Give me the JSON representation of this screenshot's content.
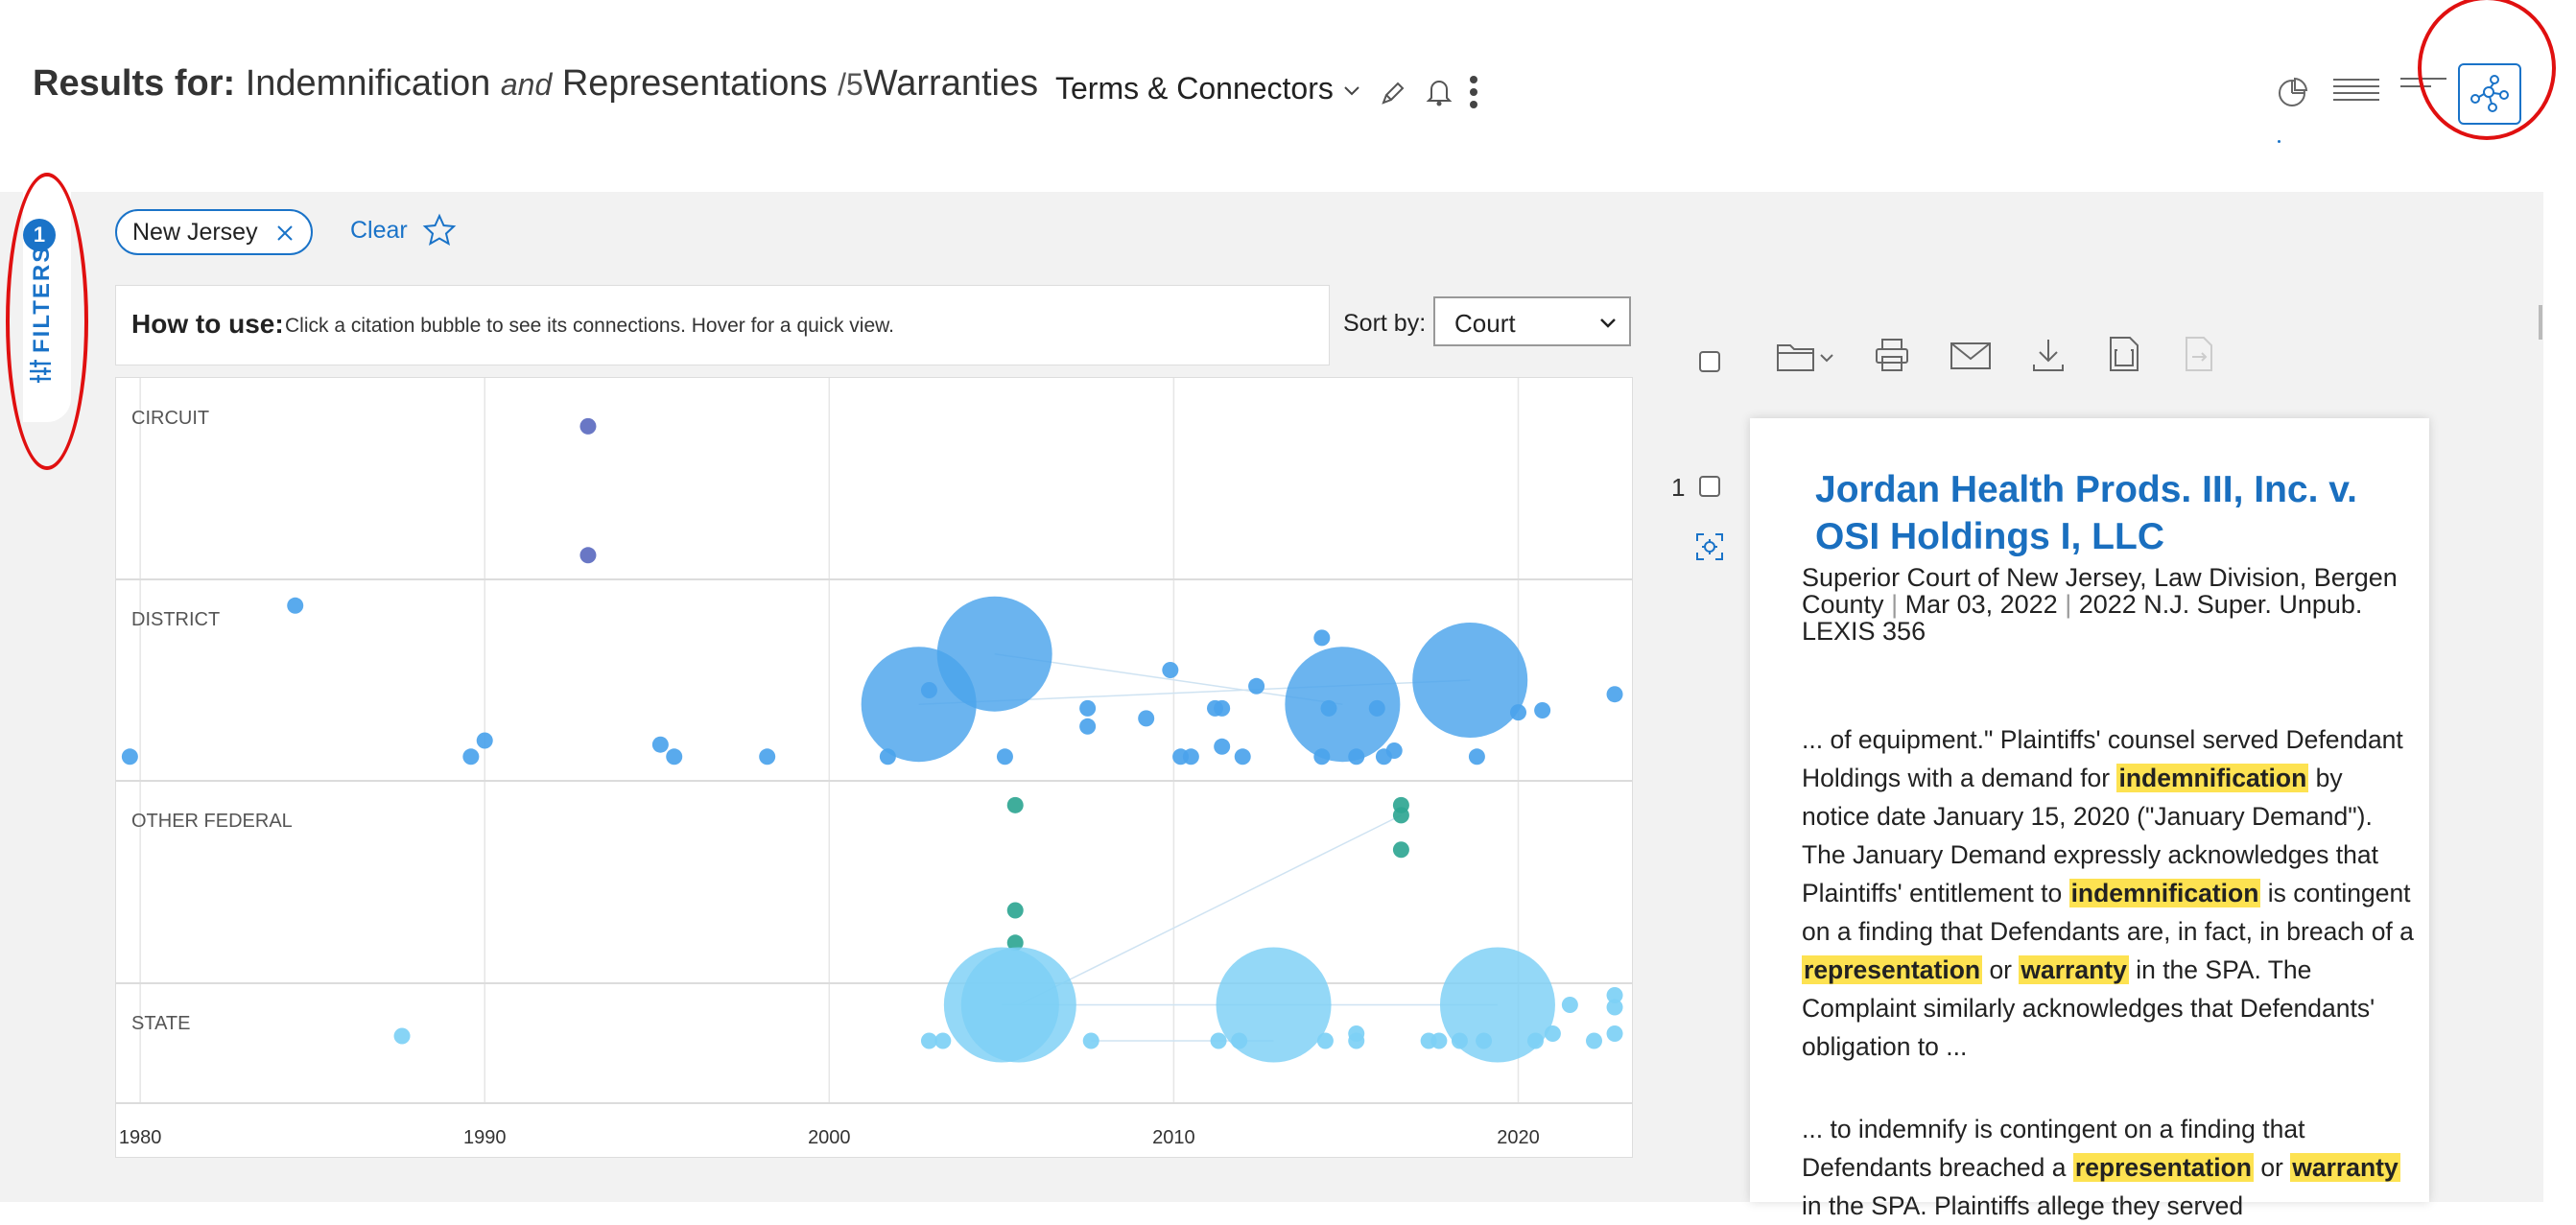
{
  "header": {
    "results_for_label": "Results for:",
    "query_term_1": "Indemnification",
    "query_connector_1": "and",
    "query_term_2": "Representations",
    "query_connector_2": "/5",
    "query_term_3": "Warranties",
    "search_type": "Terms & Connectors"
  },
  "filters": {
    "tab_label": "FILTERS",
    "count": "1",
    "active_chip": "New Jersey",
    "clear_label": "Clear"
  },
  "howto": {
    "label": "How to use:",
    "text": "Click a citation bubble to see its connections. Hover for a quick view."
  },
  "sort": {
    "label": "Sort by:",
    "selected": "Court"
  },
  "chart_data": {
    "type": "scatter",
    "categories": [
      "CIRCUIT",
      "DISTRICT",
      "OTHER FEDERAL",
      "STATE"
    ],
    "x_ticks": [
      "1980",
      "1990",
      "2000",
      "2010",
      "2020"
    ],
    "xlim": [
      1979.3,
      2023.3
    ],
    "series": [
      {
        "category": "CIRCUIT",
        "color": "#5c6bc0",
        "points": [
          {
            "x": 1993.0,
            "lane_pos": 0.24,
            "size": "small"
          },
          {
            "x": 1993.0,
            "lane_pos": 0.88,
            "size": "small"
          }
        ]
      },
      {
        "category": "DISTRICT",
        "color": "#4ba3ec",
        "points": [
          {
            "x": 1979.7,
            "lane_pos": 0.88,
            "size": "small"
          },
          {
            "x": 1984.5,
            "lane_pos": 0.13,
            "size": "small"
          },
          {
            "x": 1989.6,
            "lane_pos": 0.88,
            "size": "small"
          },
          {
            "x": 1990.0,
            "lane_pos": 0.8,
            "size": "small"
          },
          {
            "x": 1995.1,
            "lane_pos": 0.82,
            "size": "small"
          },
          {
            "x": 1995.5,
            "lane_pos": 0.88,
            "size": "small"
          },
          {
            "x": 1998.2,
            "lane_pos": 0.88,
            "size": "small"
          },
          {
            "x": 2001.7,
            "lane_pos": 0.88,
            "size": "small"
          },
          {
            "x": 2002.6,
            "lane_pos": 0.62,
            "size": "large"
          },
          {
            "x": 2002.9,
            "lane_pos": 0.55,
            "size": "small"
          },
          {
            "x": 2004.8,
            "lane_pos": 0.37,
            "size": "large"
          },
          {
            "x": 2005.1,
            "lane_pos": 0.88,
            "size": "small"
          },
          {
            "x": 2007.5,
            "lane_pos": 0.64,
            "size": "small"
          },
          {
            "x": 2007.5,
            "lane_pos": 0.73,
            "size": "small"
          },
          {
            "x": 2009.2,
            "lane_pos": 0.69,
            "size": "small"
          },
          {
            "x": 2009.9,
            "lane_pos": 0.45,
            "size": "small"
          },
          {
            "x": 2010.2,
            "lane_pos": 0.88,
            "size": "small"
          },
          {
            "x": 2010.5,
            "lane_pos": 0.88,
            "size": "small"
          },
          {
            "x": 2011.2,
            "lane_pos": 0.64,
            "size": "small"
          },
          {
            "x": 2011.4,
            "lane_pos": 0.64,
            "size": "small"
          },
          {
            "x": 2011.4,
            "lane_pos": 0.83,
            "size": "small"
          },
          {
            "x": 2012.0,
            "lane_pos": 0.88,
            "size": "small"
          },
          {
            "x": 2012.4,
            "lane_pos": 0.53,
            "size": "small"
          },
          {
            "x": 2014.3,
            "lane_pos": 0.29,
            "size": "small"
          },
          {
            "x": 2014.3,
            "lane_pos": 0.88,
            "size": "small"
          },
          {
            "x": 2014.5,
            "lane_pos": 0.64,
            "size": "small"
          },
          {
            "x": 2014.9,
            "lane_pos": 0.62,
            "size": "large"
          },
          {
            "x": 2015.3,
            "lane_pos": 0.88,
            "size": "small"
          },
          {
            "x": 2015.9,
            "lane_pos": 0.64,
            "size": "small"
          },
          {
            "x": 2016.1,
            "lane_pos": 0.88,
            "size": "small"
          },
          {
            "x": 2016.4,
            "lane_pos": 0.85,
            "size": "small"
          },
          {
            "x": 2018.6,
            "lane_pos": 0.5,
            "size": "large"
          },
          {
            "x": 2018.8,
            "lane_pos": 0.88,
            "size": "small"
          },
          {
            "x": 2020.0,
            "lane_pos": 0.66,
            "size": "small"
          },
          {
            "x": 2020.7,
            "lane_pos": 0.65,
            "size": "small"
          },
          {
            "x": 2022.8,
            "lane_pos": 0.57,
            "size": "small"
          }
        ]
      },
      {
        "category": "OTHER FEDERAL",
        "color": "#2fa693",
        "points": [
          {
            "x": 2005.4,
            "lane_pos": 0.12,
            "size": "small"
          },
          {
            "x": 2005.4,
            "lane_pos": 0.64,
            "size": "small"
          },
          {
            "x": 2005.4,
            "lane_pos": 0.8,
            "size": "small"
          },
          {
            "x": 2016.6,
            "lane_pos": 0.12,
            "size": "small"
          },
          {
            "x": 2016.6,
            "lane_pos": 0.17,
            "size": "small"
          },
          {
            "x": 2016.6,
            "lane_pos": 0.34,
            "size": "small"
          }
        ]
      },
      {
        "category": "STATE",
        "color": "#7dd0f5",
        "points": [
          {
            "x": 1987.6,
            "lane_pos": 0.44,
            "size": "small"
          },
          {
            "x": 2002.9,
            "lane_pos": 0.48,
            "size": "small"
          },
          {
            "x": 2003.3,
            "lane_pos": 0.48,
            "size": "small"
          },
          {
            "x": 2005.0,
            "lane_pos": 0.18,
            "size": "large"
          },
          {
            "x": 2005.5,
            "lane_pos": 0.18,
            "size": "large"
          },
          {
            "x": 2007.6,
            "lane_pos": 0.48,
            "size": "small"
          },
          {
            "x": 2011.3,
            "lane_pos": 0.48,
            "size": "small"
          },
          {
            "x": 2011.9,
            "lane_pos": 0.48,
            "size": "small"
          },
          {
            "x": 2012.9,
            "lane_pos": 0.18,
            "size": "large"
          },
          {
            "x": 2014.4,
            "lane_pos": 0.48,
            "size": "small"
          },
          {
            "x": 2015.3,
            "lane_pos": 0.42,
            "size": "small"
          },
          {
            "x": 2015.3,
            "lane_pos": 0.48,
            "size": "small"
          },
          {
            "x": 2017.4,
            "lane_pos": 0.48,
            "size": "small"
          },
          {
            "x": 2017.7,
            "lane_pos": 0.48,
            "size": "small"
          },
          {
            "x": 2018.3,
            "lane_pos": 0.48,
            "size": "small"
          },
          {
            "x": 2019.0,
            "lane_pos": 0.48,
            "size": "small"
          },
          {
            "x": 2019.4,
            "lane_pos": 0.18,
            "size": "large"
          },
          {
            "x": 2020.5,
            "lane_pos": 0.48,
            "size": "small"
          },
          {
            "x": 2021.0,
            "lane_pos": 0.42,
            "size": "small"
          },
          {
            "x": 2021.5,
            "lane_pos": 0.18,
            "size": "small"
          },
          {
            "x": 2022.2,
            "lane_pos": 0.48,
            "size": "small"
          },
          {
            "x": 2022.8,
            "lane_pos": 0.1,
            "size": "small"
          },
          {
            "x": 2022.8,
            "lane_pos": 0.2,
            "size": "small"
          },
          {
            "x": 2022.8,
            "lane_pos": 0.42,
            "size": "small"
          }
        ]
      }
    ],
    "connections": [
      [
        2004.8,
        "DISTRICT",
        0.37,
        2014.9,
        "DISTRICT",
        0.62
      ],
      [
        2005.5,
        "STATE",
        0.18,
        2016.6,
        "OTHER FEDERAL",
        0.17
      ],
      [
        2005.0,
        "STATE",
        0.18,
        2019.4,
        "STATE",
        0.18
      ],
      [
        2002.6,
        "DISTRICT",
        0.62,
        2018.6,
        "DISTRICT",
        0.5
      ],
      [
        2007.6,
        "STATE",
        0.48,
        2012.9,
        "STATE",
        0.48
      ]
    ]
  },
  "result": {
    "index": "1",
    "title": "Jordan Health Prods. III, Inc. v. OSI Holdings I, LLC",
    "court": "Superior Court of New Jersey, Law Division, Bergen County",
    "date": "Mar 03, 2022",
    "citation": "2022 N.J. Super. Unpub. LEXIS 356",
    "snippet1_a": "... of equipment.\" Plaintiffs' counsel served Defendant Holdings with a demand for ",
    "snippet1_hl1": "indemnification",
    "snippet1_b": " by notice date January 15, 2020 (\"January Demand\"). The January Demand expressly acknowledges that Plaintiffs' entitlement to ",
    "snippet1_hl2": "indemnification",
    "snippet1_c": " is contingent on a finding that Defendants are, in fact, in breach of a ",
    "snippet1_hl3": "representation",
    "snippet1_d": " or ",
    "snippet1_hl4": "warranty",
    "snippet1_e": " in the SPA. The Complaint similarly acknowledges that Defendants' obligation to ...",
    "snippet2_a": "... to indemnify is contingent on a finding that Defendants breached a ",
    "snippet2_hl1": "representation",
    "snippet2_b": " or ",
    "snippet2_hl2": "warranty",
    "snippet2_c": " in the SPA. Plaintiffs allege they served"
  }
}
